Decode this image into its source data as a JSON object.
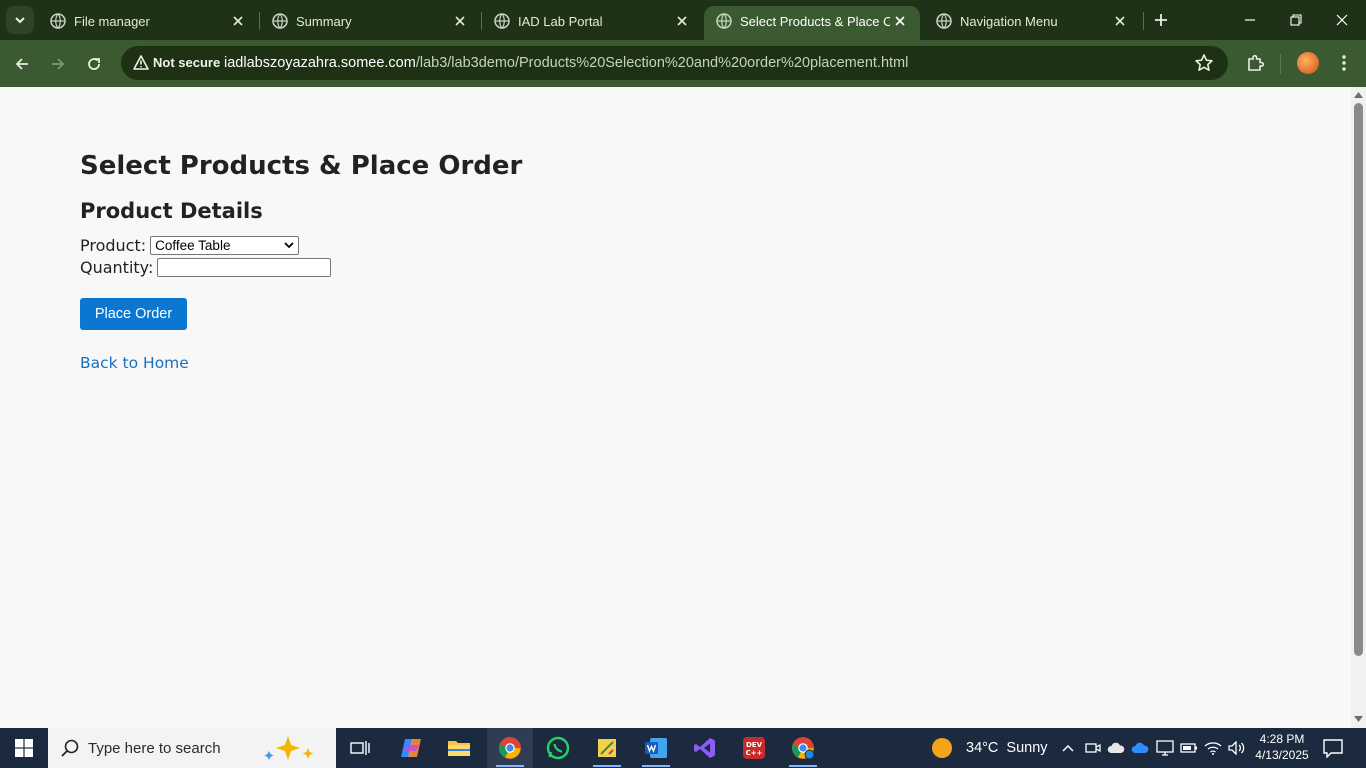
{
  "browser": {
    "tabs": [
      {
        "title": "File manager",
        "active": false
      },
      {
        "title": "Summary",
        "active": false
      },
      {
        "title": "IAD Lab Portal",
        "active": false
      },
      {
        "title": "Select Products & Place Ord",
        "active": true
      },
      {
        "title": "Navigation Menu",
        "active": false
      }
    ],
    "security_label": "Not secure",
    "url_host": "iadlabszoyazahra.somee.com",
    "url_path": "/lab3/lab3demo/Products%20Selection%20and%20order%20placement.html",
    "accent_color": "#3c5a31"
  },
  "page": {
    "title": "Select Products & Place Order",
    "section_title": "Product Details",
    "product_label": "Product:",
    "product_selected": "Coffee Table",
    "quantity_label": "Quantity:",
    "quantity_value": "",
    "place_order_label": "Place Order",
    "back_link": "Back to Home",
    "button_color": "#0b77d0",
    "link_color": "#1a6fc0"
  },
  "taskbar": {
    "search_placeholder": "Type here to search",
    "apps": [
      "copilot-icon",
      "file-explorer-icon",
      "chrome-icon",
      "whatsapp-icon",
      "sticky-app-icon",
      "word-icon",
      "visual-studio-icon",
      "dev-cpp-icon",
      "chrome-profile-icon"
    ],
    "weather_temp": "34°C",
    "weather_desc": "Sunny",
    "time": "4:28 PM",
    "date": "4/13/2025"
  }
}
